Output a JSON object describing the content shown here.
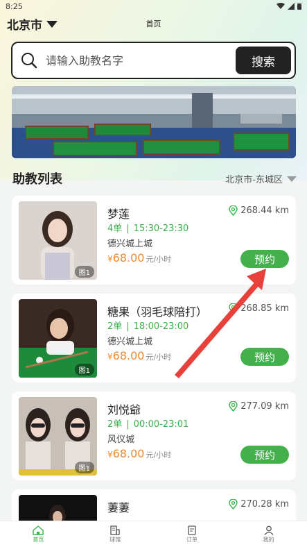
{
  "status_bar": {
    "time": "8:25"
  },
  "header": {
    "city": "北京市",
    "page_title": "首页"
  },
  "search": {
    "placeholder": "请输入助教名字",
    "button_label": "搜索"
  },
  "section": {
    "title": "助教列表",
    "district": "北京市-东城区"
  },
  "cards": [
    {
      "name": "梦莲",
      "distance": "268.44 km",
      "orders": "4单",
      "hours": "15:30-23:30",
      "venue": "德兴城上城",
      "price": "68.00",
      "currency": "¥",
      "unit": "元/小时",
      "book_label": "预约",
      "img_badge": "图1"
    },
    {
      "name": "糖果（羽毛球陪打）",
      "distance": "268.85 km",
      "orders": "2单",
      "hours": "18:00-23:00",
      "venue": "德兴城上城",
      "price": "68.00",
      "currency": "¥",
      "unit": "元/小时",
      "book_label": "预约",
      "img_badge": "图1"
    },
    {
      "name": "刘悦爺",
      "distance": "277.09 km",
      "orders": "2单",
      "hours": "00:00-23:01",
      "venue": "风仪城",
      "price": "68.00",
      "currency": "¥",
      "unit": "元/小时",
      "book_label": "预约",
      "img_badge": "图1"
    },
    {
      "name": "萋萋",
      "distance": "270.28 km",
      "orders": "",
      "hours": "",
      "venue": "",
      "price": "",
      "currency": "",
      "unit": "",
      "book_label": "",
      "img_badge": ""
    }
  ],
  "tabbar": [
    {
      "label": "首页",
      "icon": "home-icon",
      "active": true
    },
    {
      "label": "球馆",
      "icon": "venue-icon",
      "active": false
    },
    {
      "label": "订单",
      "icon": "orders-icon",
      "active": false
    },
    {
      "label": "我的",
      "icon": "profile-icon",
      "active": false
    }
  ],
  "colors": {
    "accent_green": "#43b04c",
    "price_orange": "#ef8a2a",
    "dark": "#222222",
    "arrow_red": "#e8403a"
  }
}
